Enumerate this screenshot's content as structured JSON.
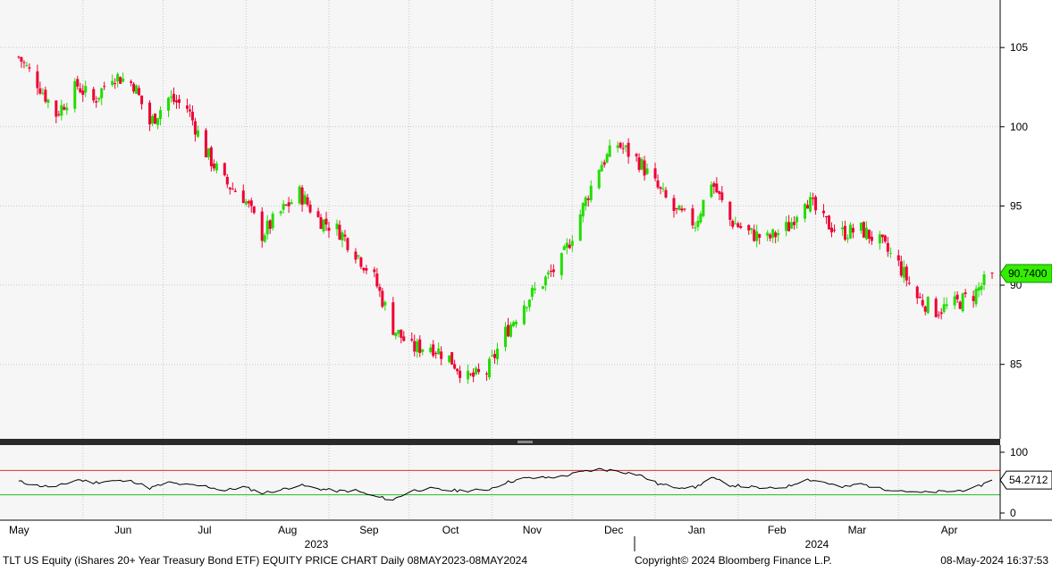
{
  "chart_data": [
    {
      "type": "candlestick",
      "panel": "price",
      "y_ticks": [
        105,
        100,
        95,
        90,
        85
      ],
      "ylim": [
        80.3,
        108
      ],
      "grid": true,
      "last_value_label": "90.7400",
      "up_color": "#22dd00",
      "down_color": "#ee0033",
      "series": [
        {
          "name": "",
          "x": [
            "2023-05-08",
            "2023-05-15",
            "2023-05-22",
            "2023-05-30",
            "2023-06-05",
            "2023-06-12",
            "2023-06-20",
            "2023-06-26",
            "2023-07-03",
            "2023-07-10",
            "2023-07-17",
            "2023-07-24",
            "2023-07-31",
            "2023-08-07",
            "2023-08-14",
            "2023-08-21",
            "2023-08-28",
            "2023-09-05",
            "2023-09-11",
            "2023-09-18",
            "2023-09-25",
            "2023-10-02",
            "2023-10-09",
            "2023-10-16",
            "2023-10-23",
            "2023-10-30",
            "2023-11-06",
            "2023-11-13",
            "2023-11-20",
            "2023-11-27",
            "2023-12-04",
            "2023-12-11",
            "2023-12-18",
            "2023-12-26",
            "2024-01-02",
            "2024-01-08",
            "2024-01-16",
            "2024-01-22",
            "2024-01-29",
            "2024-02-05",
            "2024-02-12",
            "2024-02-20",
            "2024-02-26",
            "2024-03-04",
            "2024-03-11",
            "2024-03-18",
            "2024-03-25",
            "2024-04-01",
            "2024-04-08",
            "2024-04-15",
            "2024-04-22",
            "2024-04-29",
            "2024-05-06"
          ],
          "values": [
            104.4,
            102.8,
            100.8,
            102.6,
            101.6,
            103.3,
            102.7,
            100.2,
            101.8,
            101.2,
            98.4,
            96.5,
            95.6,
            93.2,
            94.6,
            95.8,
            94.2,
            93.4,
            92.1,
            90.4,
            87.3,
            86.0,
            86.2,
            85.4,
            84.1,
            84.5,
            87.0,
            88.9,
            90.2,
            91.5,
            94.5,
            97.5,
            98.9,
            97.8,
            96.1,
            94.7,
            93.9,
            96.6,
            94.1,
            93.3,
            92.9,
            93.7,
            95.6,
            94.0,
            93.3,
            93.5,
            92.7,
            91.3,
            89.2,
            88.4,
            88.8,
            89.4,
            90.74
          ]
        }
      ]
    },
    {
      "type": "line",
      "panel": "indicator",
      "y_ticks": [
        100,
        0
      ],
      "ylim": [
        0,
        100
      ],
      "upper_line": 70,
      "lower_line": 30,
      "last_value_label": "54.2712",
      "series": [
        {
          "name": "",
          "x": [
            "2023-05-08",
            "2023-05-15",
            "2023-05-22",
            "2023-05-30",
            "2023-06-05",
            "2023-06-12",
            "2023-06-20",
            "2023-06-26",
            "2023-07-03",
            "2023-07-10",
            "2023-07-17",
            "2023-07-24",
            "2023-07-31",
            "2023-08-07",
            "2023-08-14",
            "2023-08-21",
            "2023-08-28",
            "2023-09-05",
            "2023-09-11",
            "2023-09-18",
            "2023-09-25",
            "2023-10-02",
            "2023-10-09",
            "2023-10-16",
            "2023-10-23",
            "2023-10-30",
            "2023-11-06",
            "2023-11-13",
            "2023-11-20",
            "2023-11-27",
            "2023-12-04",
            "2023-12-11",
            "2023-12-18",
            "2023-12-26",
            "2024-01-02",
            "2024-01-08",
            "2024-01-16",
            "2024-01-22",
            "2024-01-29",
            "2024-02-05",
            "2024-02-12",
            "2024-02-20",
            "2024-02-26",
            "2024-03-04",
            "2024-03-11",
            "2024-03-18",
            "2024-03-25",
            "2024-04-01",
            "2024-04-08",
            "2024-04-15",
            "2024-04-22",
            "2024-04-29",
            "2024-05-06"
          ],
          "values": [
            52,
            45,
            43,
            55,
            50,
            53,
            52,
            41,
            50,
            46,
            44,
            37,
            43,
            33,
            38,
            46,
            40,
            36,
            37,
            27,
            22,
            37,
            40,
            37,
            37,
            38,
            50,
            57,
            58,
            60,
            67,
            72,
            69,
            63,
            48,
            43,
            42,
            58,
            46,
            43,
            40,
            44,
            56,
            51,
            42,
            48,
            40,
            38,
            33,
            35,
            36,
            40,
            54.27
          ]
        }
      ]
    }
  ],
  "x_axis": {
    "months": [
      "May",
      "Jun",
      "Jul",
      "Aug",
      "Sep",
      "Oct",
      "Nov",
      "Dec",
      "Jan",
      "Feb",
      "Mar",
      "Apr"
    ],
    "years": [
      "2023",
      "2024"
    ]
  },
  "footer": {
    "left": "TLT US Equity (iShares 20+ Year Treasury Bond ETF) EQUITY PRICE CHART  Daily 08MAY2023-08MAY2024",
    "copyright": "Copyright© 2024 Bloomberg Finance L.P.",
    "timestamp": "08-May-2024 16:37:53"
  },
  "colors": {
    "grid": "#c8c8c8",
    "upper_line": "#e03030",
    "lower_line": "#22bb22",
    "label_bg": "#33ee00",
    "indicator_line": "#000000"
  }
}
